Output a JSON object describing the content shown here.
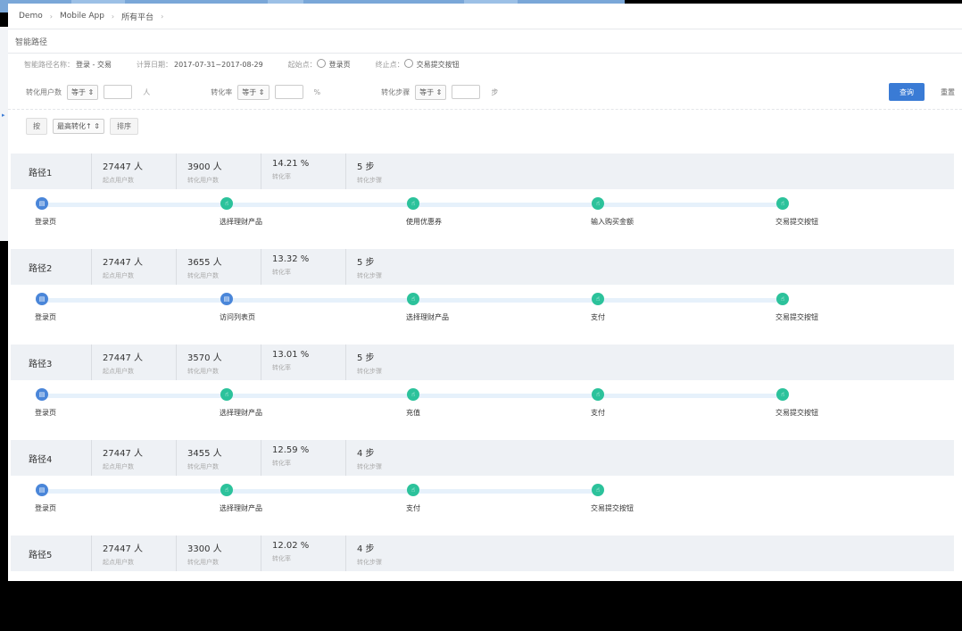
{
  "breadcrumb": [
    "Demo",
    "Mobile App",
    "所有平台"
  ],
  "breadcrumb_sep": "›",
  "page_title": "智能路径",
  "info": {
    "name_label": "智能路径名称：",
    "name_value": "登录 - 交易",
    "date_label": "计算日期：",
    "date_value": "2017-07-31~2017-08-29",
    "start_label": "起始点：",
    "start_value": "登录页",
    "end_label": "终止点：",
    "end_value": "交易提交按钮"
  },
  "filters": [
    {
      "label": "转化用户数",
      "op": "等于 ⇕",
      "unit": "人"
    },
    {
      "label": "转化率",
      "op": "等于 ⇕",
      "unit": "%"
    },
    {
      "label": "转化步骤",
      "op": "等于 ⇕",
      "unit": "步"
    }
  ],
  "buttons": {
    "query": "查询",
    "reset": "重置"
  },
  "sort": {
    "by_label": "按",
    "field": "最高转化↑ ⇕",
    "sort_label": "排序"
  },
  "stat_labels": [
    "起点用户数",
    "转化用户数",
    "转化率",
    "转化步骤"
  ],
  "paths": [
    {
      "name": "路径1",
      "stats": [
        "27447 人",
        "3900 人",
        "14.21 %",
        "5 步"
      ],
      "steps": [
        {
          "label": "登录页",
          "type": "blue"
        },
        {
          "label": "选择理财产品",
          "type": "green"
        },
        {
          "label": "使用优惠券",
          "type": "green"
        },
        {
          "label": "输入购买金额",
          "type": "green"
        },
        {
          "label": "交易提交按钮",
          "type": "green"
        }
      ]
    },
    {
      "name": "路径2",
      "stats": [
        "27447 人",
        "3655 人",
        "13.32 %",
        "5 步"
      ],
      "steps": [
        {
          "label": "登录页",
          "type": "blue"
        },
        {
          "label": "访问列表页",
          "type": "blue"
        },
        {
          "label": "选择理财产品",
          "type": "green"
        },
        {
          "label": "支付",
          "type": "green"
        },
        {
          "label": "交易提交按钮",
          "type": "green"
        }
      ]
    },
    {
      "name": "路径3",
      "stats": [
        "27447 人",
        "3570 人",
        "13.01 %",
        "5 步"
      ],
      "steps": [
        {
          "label": "登录页",
          "type": "blue"
        },
        {
          "label": "选择理财产品",
          "type": "green"
        },
        {
          "label": "充值",
          "type": "green"
        },
        {
          "label": "支付",
          "type": "green"
        },
        {
          "label": "交易提交按钮",
          "type": "green"
        }
      ]
    },
    {
      "name": "路径4",
      "stats": [
        "27447 人",
        "3455 人",
        "12.59 %",
        "4 步"
      ],
      "steps": [
        {
          "label": "登录页",
          "type": "blue"
        },
        {
          "label": "选择理财产品",
          "type": "green"
        },
        {
          "label": "支付",
          "type": "green"
        },
        {
          "label": "交易提交按钮",
          "type": "green"
        }
      ]
    },
    {
      "name": "路径5",
      "stats": [
        "27447 人",
        "3300 人",
        "12.02 %",
        "4 步"
      ],
      "steps": []
    }
  ],
  "colors": {
    "accent": "#3a7bd5",
    "node_blue": "#4a86d9",
    "node_green": "#2cc29b",
    "card_head": "#eef1f5"
  },
  "icons": {
    "blue_node": "page-icon",
    "green_node": "hand-pointer-icon",
    "location": "location-pin-icon"
  }
}
